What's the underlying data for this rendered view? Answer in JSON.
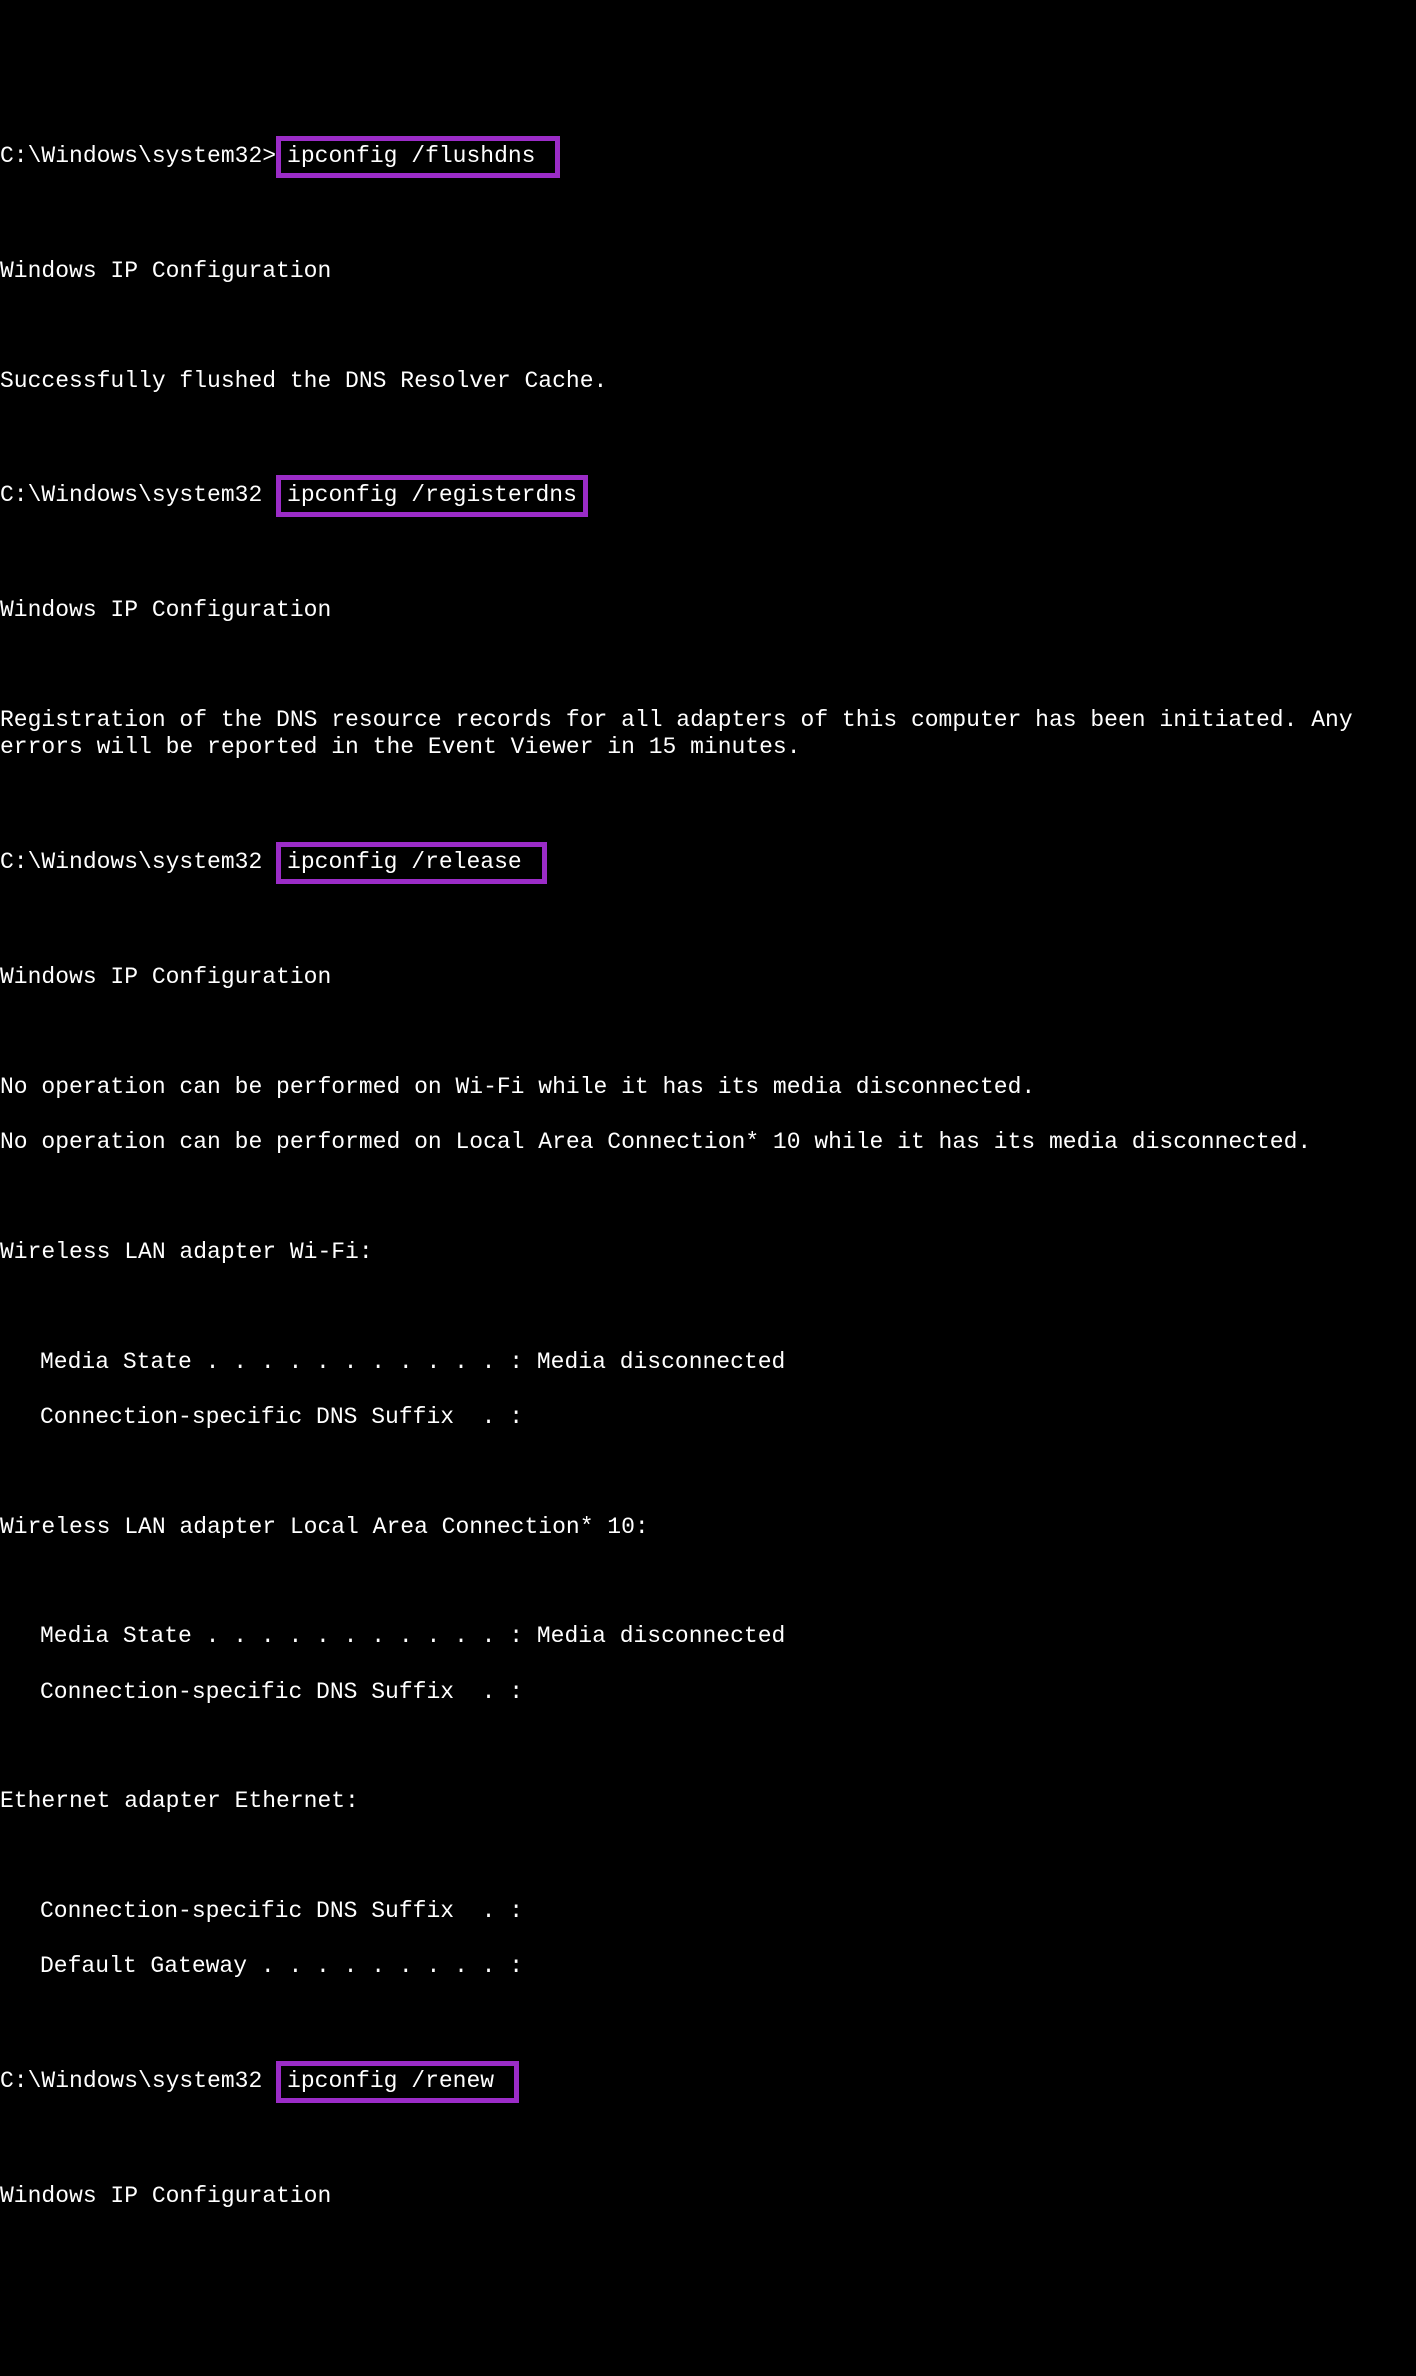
{
  "prompt": "C:\\Windows\\system32>",
  "prompt_no_arrow": "C:\\Windows\\system32 ",
  "commands": {
    "flushdns": "ipconfig /flushdns ",
    "registerdns": "ipconfig /registerdns",
    "release": "ipconfig /release ",
    "renew": "ipconfig /renew "
  },
  "output": {
    "ip_config_header": "Windows IP Configuration",
    "flush_success": "Successfully flushed the DNS Resolver Cache.",
    "register_msg": "Registration of the DNS resource records for all adapters of this computer has been initiated. Any errors will be reported in the Event Viewer in 15 minutes.",
    "release": {
      "wifi_error": "No operation can be performed on Wi-Fi while it has its media disconnected.",
      "lac_error": "No operation can be performed on Local Area Connection* 10 while it has its media disconnected.",
      "adapter1": {
        "header": "Wireless LAN adapter Wi-Fi:",
        "media_state": "Media State . . . . . . . . . . . : Media disconnected",
        "dns_suffix": "Connection-specific DNS Suffix  . :"
      },
      "adapter2": {
        "header": "Wireless LAN adapter Local Area Connection* 10:",
        "media_state": "Media State . . . . . . . . . . . : Media disconnected",
        "dns_suffix": "Connection-specific DNS Suffix  . :"
      },
      "adapter3": {
        "header": "Ethernet adapter Ethernet:",
        "dns_suffix": "Connection-specific DNS Suffix  . :",
        "gateway": "Default Gateway . . . . . . . . . :"
      }
    }
  },
  "highlight_color": "#9b2cc7"
}
